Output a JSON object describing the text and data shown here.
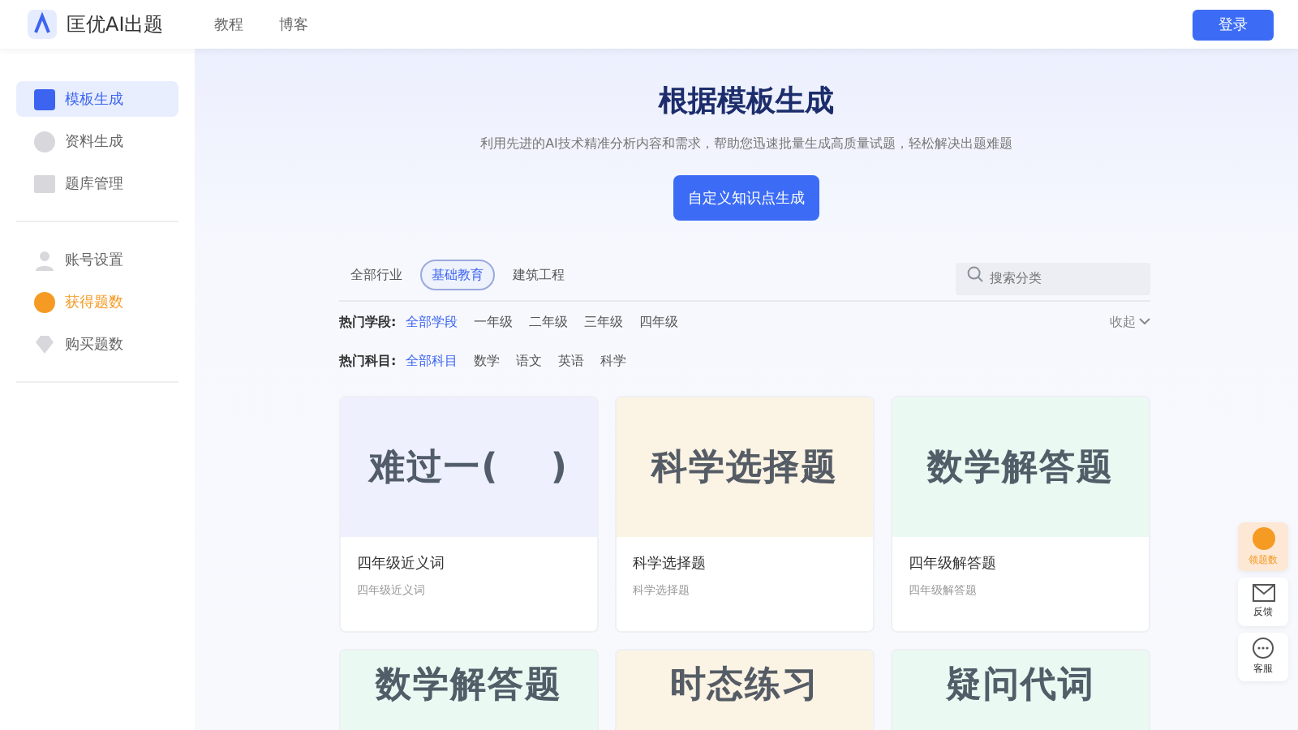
{
  "header": {
    "logo_text": "匡优AI出题",
    "nav": [
      {
        "label": "教程"
      },
      {
        "label": "博客"
      }
    ],
    "login_button": "登录"
  },
  "sidebar": {
    "groups": [
      [
        {
          "label": "模板生成",
          "kind": "template",
          "selected": true
        },
        {
          "label": "资料生成",
          "kind": "doc",
          "selected": false
        },
        {
          "label": "题库管理",
          "kind": "bank",
          "selected": false
        }
      ],
      [
        {
          "label": "账号设置",
          "kind": "user",
          "selected": false
        },
        {
          "label": "获得题数",
          "kind": "coin",
          "selected": false,
          "highlight": true
        },
        {
          "label": "购买题数",
          "kind": "gem",
          "selected": false
        }
      ]
    ]
  },
  "hero": {
    "title": "根据模板生成",
    "subtitle": "利用先进的AI技术精准分析内容和需求，帮助您迅速批量生成高质量试题，轻松解决出题难题",
    "button": "自定义知识点生成"
  },
  "industry_tabs": [
    {
      "label": "全部行业",
      "selected": false
    },
    {
      "label": "基础教育",
      "selected": true
    },
    {
      "label": "建筑工程",
      "selected": false
    }
  ],
  "search": {
    "placeholder": "搜索分类"
  },
  "filters": [
    {
      "label": "热门学段:",
      "options": [
        {
          "label": "全部学段",
          "selected": true
        },
        {
          "label": "一年级",
          "selected": false
        },
        {
          "label": "二年级",
          "selected": false
        },
        {
          "label": "三年级",
          "selected": false
        },
        {
          "label": "四年级",
          "selected": false
        }
      ],
      "toggle": "收起"
    },
    {
      "label": "热门科目:",
      "options": [
        {
          "label": "全部科目",
          "selected": true
        },
        {
          "label": "数学",
          "selected": false
        },
        {
          "label": "语文",
          "selected": false
        },
        {
          "label": "英语",
          "selected": false
        },
        {
          "label": "科学",
          "selected": false
        }
      ]
    }
  ],
  "cards": [
    {
      "cover": "难过一(　 )",
      "title": "四年级近义词",
      "desc": "四年级近义词",
      "color": "#eef0fd"
    },
    {
      "cover": "科学选择题",
      "title": "科学选择题",
      "desc": "科学选择题",
      "color": "#fbf3e4"
    },
    {
      "cover": "数学解答题",
      "title": "四年级解答题",
      "desc": "四年级解答题",
      "color": "#eafaf2"
    },
    {
      "cover": "数学解答题",
      "color": "#eafaf2"
    },
    {
      "cover": "时态练习",
      "color": "#fbf3e4"
    },
    {
      "cover": "疑问代词",
      "color": "#eafaf2"
    }
  ],
  "float_tools": [
    {
      "label": "领题数",
      "kind": "coin"
    },
    {
      "label": "反馈",
      "kind": "mail"
    },
    {
      "label": "客服",
      "kind": "chat"
    }
  ]
}
